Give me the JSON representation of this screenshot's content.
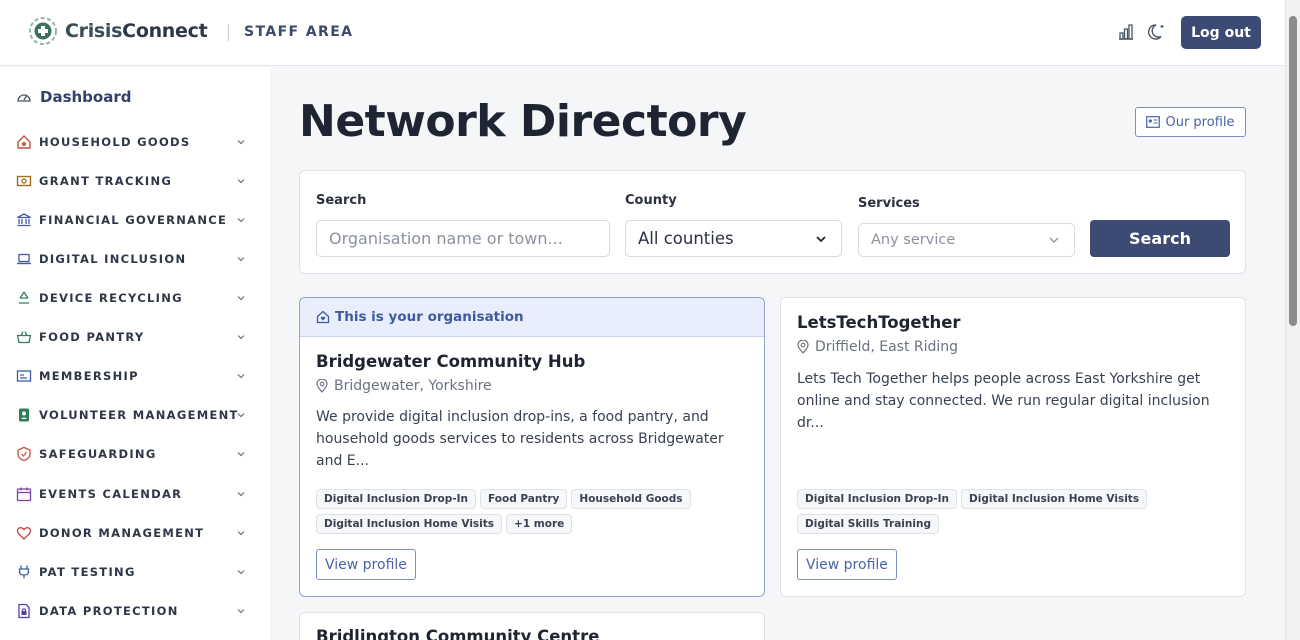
{
  "header": {
    "brand_part1": "Crisis",
    "brand_part2": "Connect",
    "area_label": "STAFF AREA",
    "icons": [
      "stats-icon",
      "dark-mode-icon"
    ],
    "logout_label": "Log out"
  },
  "sidebar": {
    "dashboard_label": "Dashboard",
    "items": [
      {
        "label": "HOUSEHOLD GOODS",
        "icon": "household-icon"
      },
      {
        "label": "GRANT TRACKING",
        "icon": "grant-icon"
      },
      {
        "label": "FINANCIAL GOVERNANCE",
        "icon": "bank-icon"
      },
      {
        "label": "DIGITAL INCLUSION",
        "icon": "laptop-icon"
      },
      {
        "label": "DEVICE RECYCLING",
        "icon": "recycle-icon"
      },
      {
        "label": "FOOD PANTRY",
        "icon": "basket-icon"
      },
      {
        "label": "MEMBERSHIP",
        "icon": "id-card-icon"
      },
      {
        "label": "VOLUNTEER MANAGEMENT",
        "icon": "volunteer-icon"
      },
      {
        "label": "SAFEGUARDING",
        "icon": "shield-icon"
      },
      {
        "label": "EVENTS CALENDAR",
        "icon": "calendar-icon"
      },
      {
        "label": "DONOR MANAGEMENT",
        "icon": "heart-icon"
      },
      {
        "label": "PAT TESTING",
        "icon": "plug-icon"
      },
      {
        "label": "DATA PROTECTION",
        "icon": "lock-file-icon"
      }
    ]
  },
  "main": {
    "title": "Network Directory",
    "our_profile_label": "Our profile",
    "search": {
      "search_label": "Search",
      "search_placeholder": "Organisation name or town...",
      "county_label": "County",
      "county_value": "All counties",
      "services_label": "Services",
      "services_value": "Any service",
      "button_label": "Search"
    },
    "cards": [
      {
        "banner": "This is your organisation",
        "name": "Bridgewater Community Hub",
        "location": "Bridgewater, Yorkshire",
        "description": "We provide digital inclusion drop-ins, a food pantry, and household goods services to residents across Bridgewater and E...",
        "tags": [
          "Digital Inclusion Drop-In",
          "Food Pantry",
          "Household Goods",
          "Digital Inclusion Home Visits",
          "+1 more"
        ],
        "view_label": "View profile"
      },
      {
        "name": "LetsTechTogether",
        "location": "Driffield, East Riding",
        "description": "Lets Tech Together helps people across East Yorkshire get online and stay connected. We run regular digital inclusion dr...",
        "tags": [
          "Digital Inclusion Drop-In",
          "Digital Inclusion Home Visits",
          "Digital Skills Training"
        ],
        "view_label": "View profile"
      },
      {
        "name": "Bridlington Community Centre"
      }
    ]
  },
  "colors": {
    "primary": "#3d4a73",
    "accent": "#4a63a8",
    "banner_bg": "#e8eefb"
  }
}
